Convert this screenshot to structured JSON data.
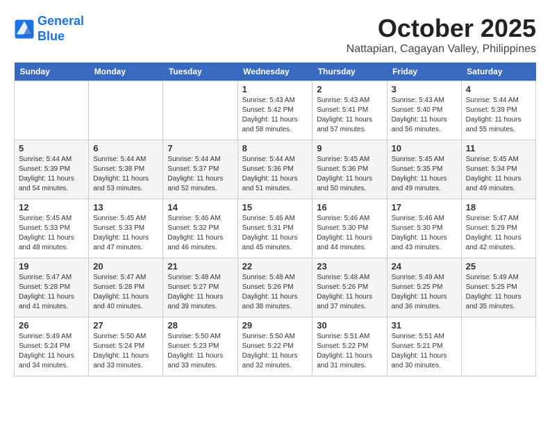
{
  "logo": {
    "line1": "General",
    "line2": "Blue"
  },
  "title": "October 2025",
  "location": "Nattapian, Cagayan Valley, Philippines",
  "weekdays": [
    "Sunday",
    "Monday",
    "Tuesday",
    "Wednesday",
    "Thursday",
    "Friday",
    "Saturday"
  ],
  "weeks": [
    [
      {
        "day": "",
        "sunrise": "",
        "sunset": "",
        "daylight": ""
      },
      {
        "day": "",
        "sunrise": "",
        "sunset": "",
        "daylight": ""
      },
      {
        "day": "",
        "sunrise": "",
        "sunset": "",
        "daylight": ""
      },
      {
        "day": "1",
        "sunrise": "Sunrise: 5:43 AM",
        "sunset": "Sunset: 5:42 PM",
        "daylight": "Daylight: 11 hours and 58 minutes."
      },
      {
        "day": "2",
        "sunrise": "Sunrise: 5:43 AM",
        "sunset": "Sunset: 5:41 PM",
        "daylight": "Daylight: 11 hours and 57 minutes."
      },
      {
        "day": "3",
        "sunrise": "Sunrise: 5:43 AM",
        "sunset": "Sunset: 5:40 PM",
        "daylight": "Daylight: 11 hours and 56 minutes."
      },
      {
        "day": "4",
        "sunrise": "Sunrise: 5:44 AM",
        "sunset": "Sunset: 5:39 PM",
        "daylight": "Daylight: 11 hours and 55 minutes."
      }
    ],
    [
      {
        "day": "5",
        "sunrise": "Sunrise: 5:44 AM",
        "sunset": "Sunset: 5:39 PM",
        "daylight": "Daylight: 11 hours and 54 minutes."
      },
      {
        "day": "6",
        "sunrise": "Sunrise: 5:44 AM",
        "sunset": "Sunset: 5:38 PM",
        "daylight": "Daylight: 11 hours and 53 minutes."
      },
      {
        "day": "7",
        "sunrise": "Sunrise: 5:44 AM",
        "sunset": "Sunset: 5:37 PM",
        "daylight": "Daylight: 11 hours and 52 minutes."
      },
      {
        "day": "8",
        "sunrise": "Sunrise: 5:44 AM",
        "sunset": "Sunset: 5:36 PM",
        "daylight": "Daylight: 11 hours and 51 minutes."
      },
      {
        "day": "9",
        "sunrise": "Sunrise: 5:45 AM",
        "sunset": "Sunset: 5:36 PM",
        "daylight": "Daylight: 11 hours and 50 minutes."
      },
      {
        "day": "10",
        "sunrise": "Sunrise: 5:45 AM",
        "sunset": "Sunset: 5:35 PM",
        "daylight": "Daylight: 11 hours and 49 minutes."
      },
      {
        "day": "11",
        "sunrise": "Sunrise: 5:45 AM",
        "sunset": "Sunset: 5:34 PM",
        "daylight": "Daylight: 11 hours and 49 minutes."
      }
    ],
    [
      {
        "day": "12",
        "sunrise": "Sunrise: 5:45 AM",
        "sunset": "Sunset: 5:33 PM",
        "daylight": "Daylight: 11 hours and 48 minutes."
      },
      {
        "day": "13",
        "sunrise": "Sunrise: 5:45 AM",
        "sunset": "Sunset: 5:33 PM",
        "daylight": "Daylight: 11 hours and 47 minutes."
      },
      {
        "day": "14",
        "sunrise": "Sunrise: 5:46 AM",
        "sunset": "Sunset: 5:32 PM",
        "daylight": "Daylight: 11 hours and 46 minutes."
      },
      {
        "day": "15",
        "sunrise": "Sunrise: 5:46 AM",
        "sunset": "Sunset: 5:31 PM",
        "daylight": "Daylight: 11 hours and 45 minutes."
      },
      {
        "day": "16",
        "sunrise": "Sunrise: 5:46 AM",
        "sunset": "Sunset: 5:30 PM",
        "daylight": "Daylight: 11 hours and 44 minutes."
      },
      {
        "day": "17",
        "sunrise": "Sunrise: 5:46 AM",
        "sunset": "Sunset: 5:30 PM",
        "daylight": "Daylight: 11 hours and 43 minutes."
      },
      {
        "day": "18",
        "sunrise": "Sunrise: 5:47 AM",
        "sunset": "Sunset: 5:29 PM",
        "daylight": "Daylight: 11 hours and 42 minutes."
      }
    ],
    [
      {
        "day": "19",
        "sunrise": "Sunrise: 5:47 AM",
        "sunset": "Sunset: 5:28 PM",
        "daylight": "Daylight: 11 hours and 41 minutes."
      },
      {
        "day": "20",
        "sunrise": "Sunrise: 5:47 AM",
        "sunset": "Sunset: 5:28 PM",
        "daylight": "Daylight: 11 hours and 40 minutes."
      },
      {
        "day": "21",
        "sunrise": "Sunrise: 5:48 AM",
        "sunset": "Sunset: 5:27 PM",
        "daylight": "Daylight: 11 hours and 39 minutes."
      },
      {
        "day": "22",
        "sunrise": "Sunrise: 5:48 AM",
        "sunset": "Sunset: 5:26 PM",
        "daylight": "Daylight: 11 hours and 38 minutes."
      },
      {
        "day": "23",
        "sunrise": "Sunrise: 5:48 AM",
        "sunset": "Sunset: 5:26 PM",
        "daylight": "Daylight: 11 hours and 37 minutes."
      },
      {
        "day": "24",
        "sunrise": "Sunrise: 5:49 AM",
        "sunset": "Sunset: 5:25 PM",
        "daylight": "Daylight: 11 hours and 36 minutes."
      },
      {
        "day": "25",
        "sunrise": "Sunrise: 5:49 AM",
        "sunset": "Sunset: 5:25 PM",
        "daylight": "Daylight: 11 hours and 35 minutes."
      }
    ],
    [
      {
        "day": "26",
        "sunrise": "Sunrise: 5:49 AM",
        "sunset": "Sunset: 5:24 PM",
        "daylight": "Daylight: 11 hours and 34 minutes."
      },
      {
        "day": "27",
        "sunrise": "Sunrise: 5:50 AM",
        "sunset": "Sunset: 5:24 PM",
        "daylight": "Daylight: 11 hours and 33 minutes."
      },
      {
        "day": "28",
        "sunrise": "Sunrise: 5:50 AM",
        "sunset": "Sunset: 5:23 PM",
        "daylight": "Daylight: 11 hours and 33 minutes."
      },
      {
        "day": "29",
        "sunrise": "Sunrise: 5:50 AM",
        "sunset": "Sunset: 5:22 PM",
        "daylight": "Daylight: 11 hours and 32 minutes."
      },
      {
        "day": "30",
        "sunrise": "Sunrise: 5:51 AM",
        "sunset": "Sunset: 5:22 PM",
        "daylight": "Daylight: 11 hours and 31 minutes."
      },
      {
        "day": "31",
        "sunrise": "Sunrise: 5:51 AM",
        "sunset": "Sunset: 5:21 PM",
        "daylight": "Daylight: 11 hours and 30 minutes."
      },
      {
        "day": "",
        "sunrise": "",
        "sunset": "",
        "daylight": ""
      }
    ]
  ]
}
